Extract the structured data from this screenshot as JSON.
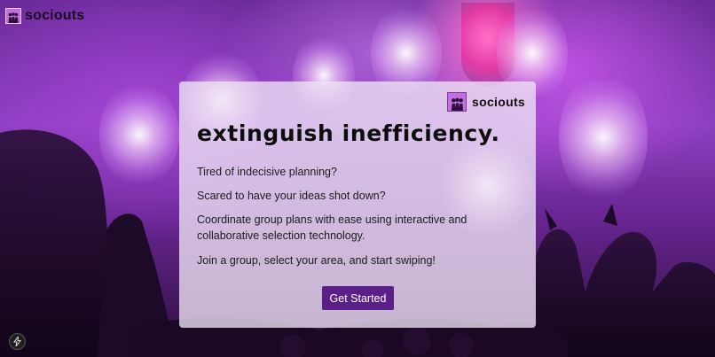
{
  "app": {
    "logo_text": "sociouts"
  },
  "card": {
    "brand_text": "sociouts",
    "headline": "extinguish inefficiency.",
    "paragraphs": [
      "Tired of indecisive planning?",
      "Scared to have your ideas shot down?",
      "Coordinate group plans with ease using interactive and collaborative selection technology.",
      "Join a group, select your area, and start swiping!"
    ],
    "cta_label": "Get Started"
  },
  "icons": {
    "logo": "people-group-icon",
    "corner_button": "lightning-bolt-icon"
  },
  "colors": {
    "brand_purple": "#5b1f88",
    "logo_purple": "#c26fe0",
    "card_background": "#eee4f5"
  }
}
